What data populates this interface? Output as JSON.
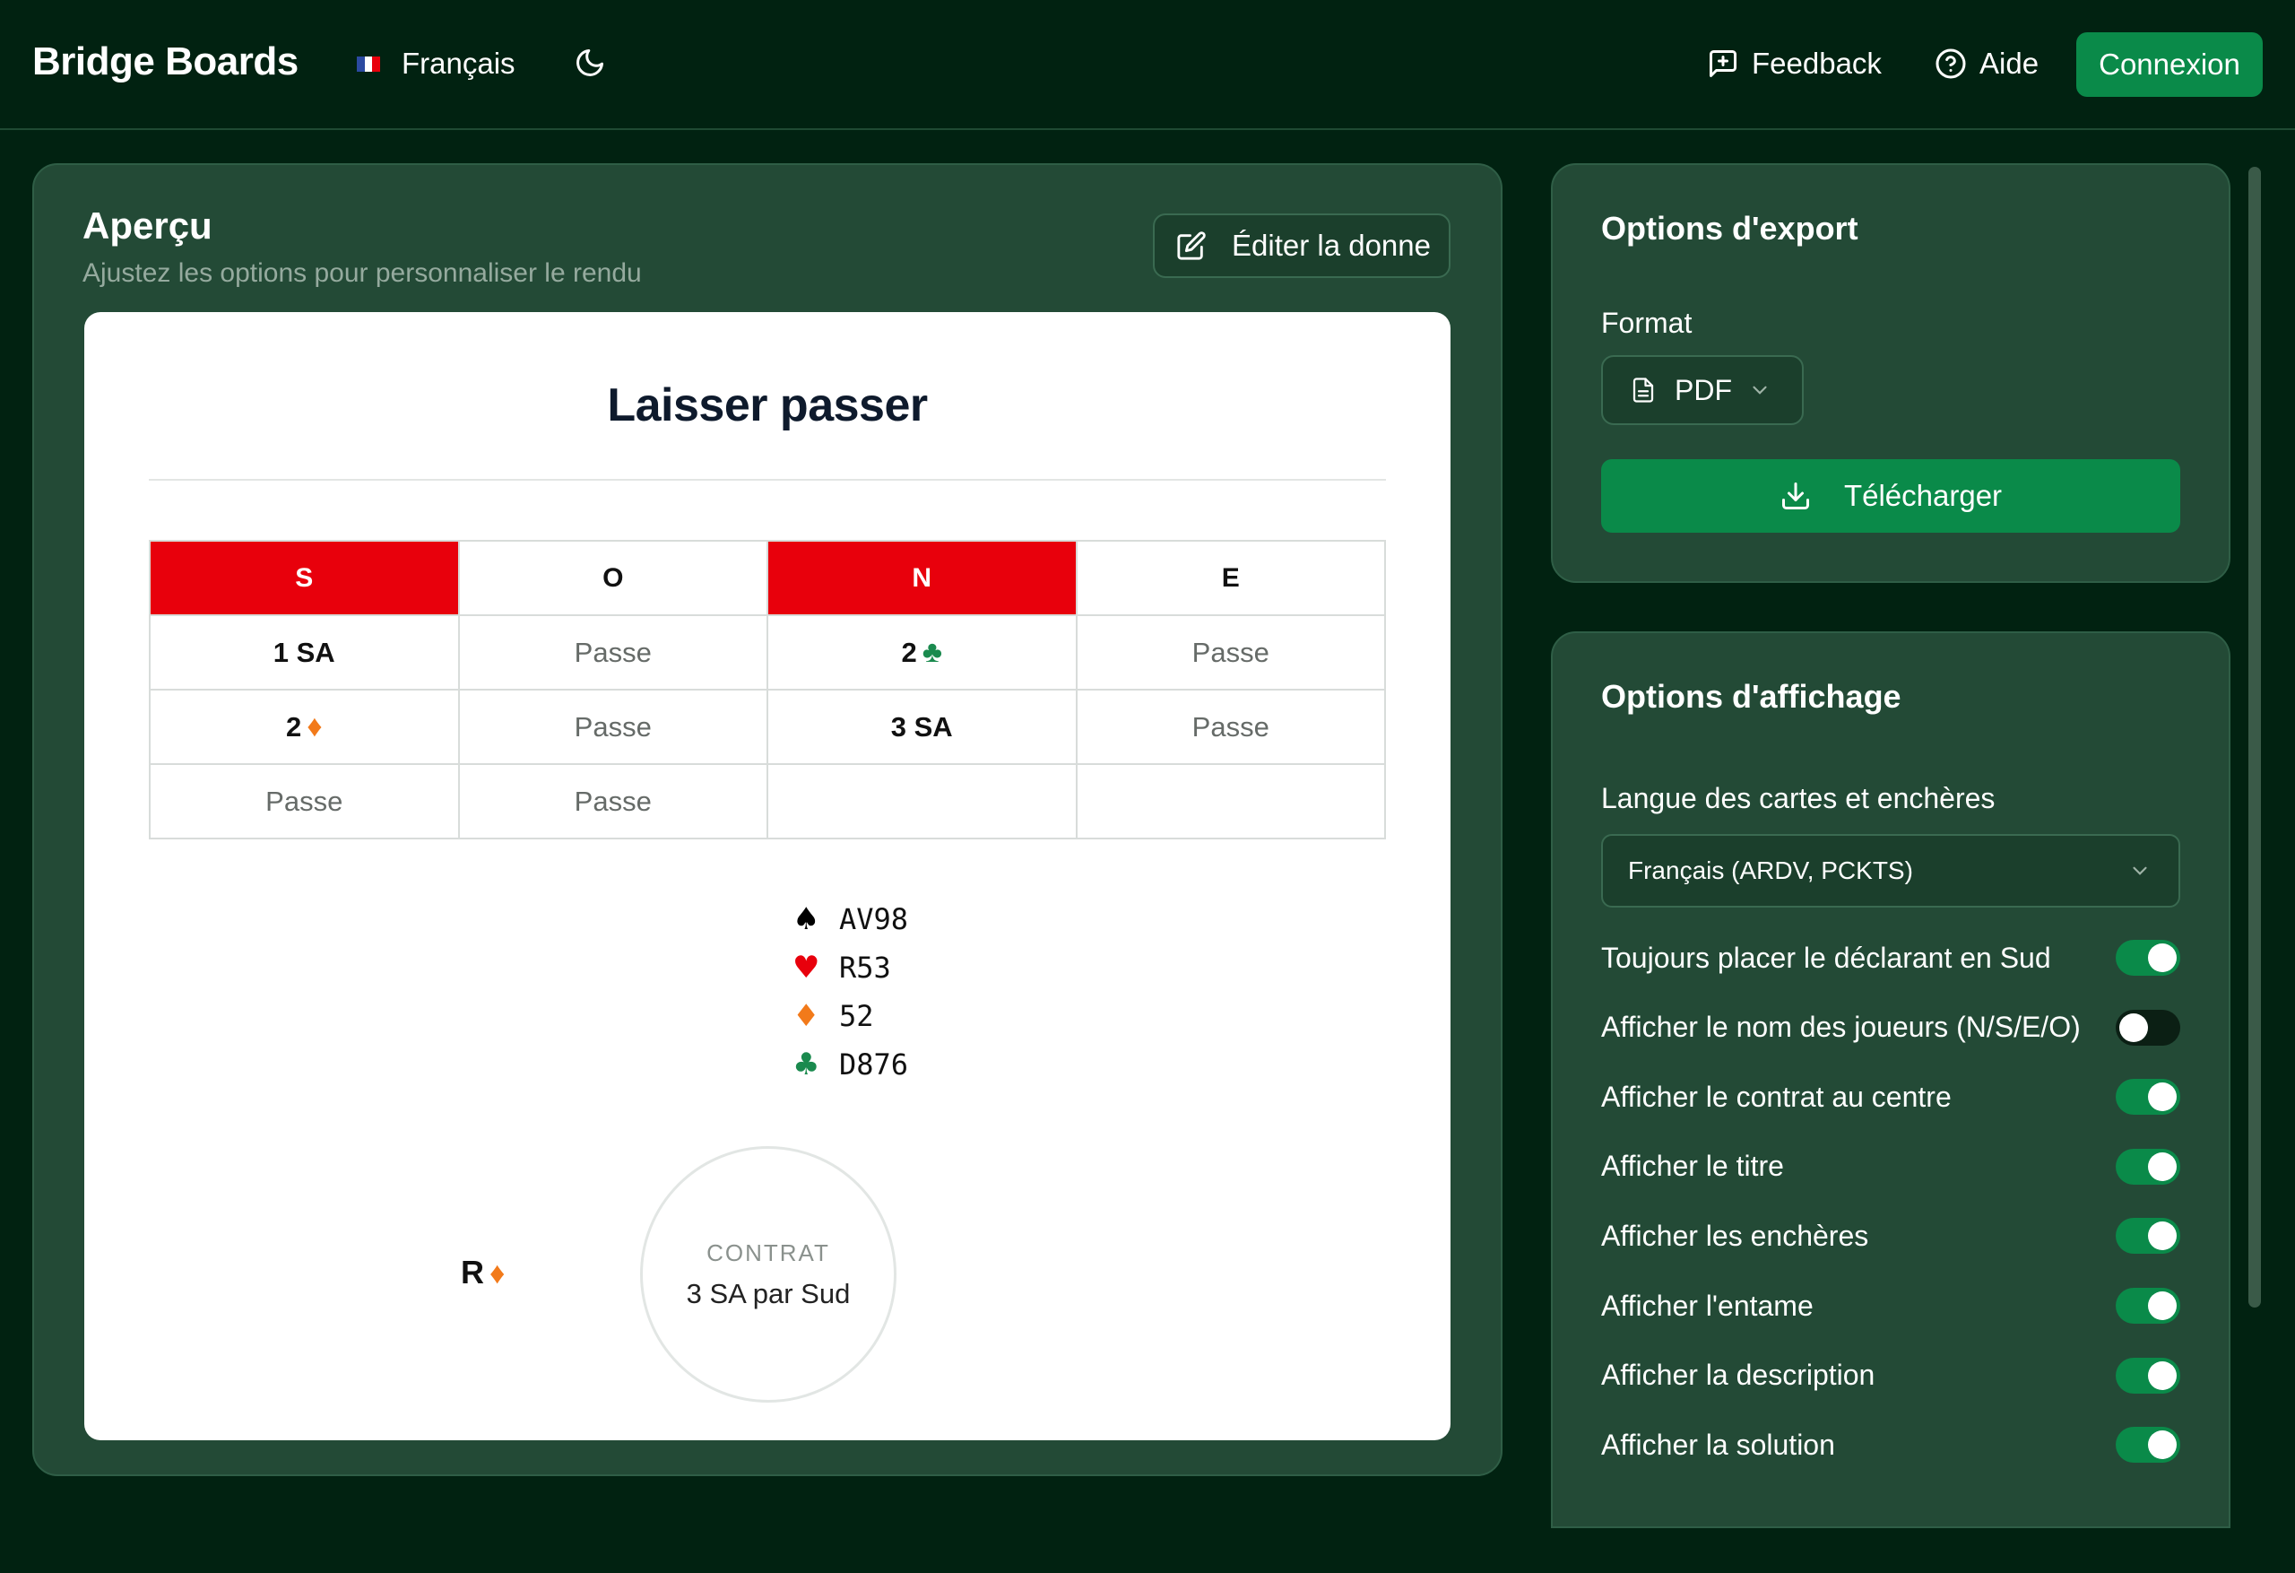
{
  "header": {
    "brand": "Bridge Boards",
    "language": "Français",
    "feedback": "Feedback",
    "help": "Aide",
    "login": "Connexion"
  },
  "preview": {
    "title": "Aperçu",
    "subtitle": "Ajustez les options pour personnaliser le rendu",
    "edit_label": "Éditer la donne",
    "board_title": "Laisser passer",
    "columns": [
      "S",
      "O",
      "N",
      "E"
    ],
    "bidding": [
      [
        {
          "text": "1 SA",
          "suit": "",
          "type": "bid"
        },
        {
          "text": "Passe",
          "suit": "",
          "type": "pass"
        },
        {
          "text": "2",
          "suit": "club",
          "type": "bid"
        },
        {
          "text": "Passe",
          "suit": "",
          "type": "pass"
        }
      ],
      [
        {
          "text": "2",
          "suit": "diamond",
          "type": "bid"
        },
        {
          "text": "Passe",
          "suit": "",
          "type": "pass"
        },
        {
          "text": "3 SA",
          "suit": "",
          "type": "bid"
        },
        {
          "text": "Passe",
          "suit": "",
          "type": "pass"
        }
      ],
      [
        {
          "text": "Passe",
          "suit": "",
          "type": "pass"
        },
        {
          "text": "Passe",
          "suit": "",
          "type": "pass"
        },
        {
          "text": "",
          "suit": "",
          "type": "empty"
        },
        {
          "text": "",
          "suit": "",
          "type": "empty"
        }
      ]
    ],
    "hand": {
      "spades": "AV98",
      "hearts": "R53",
      "diamonds": "52",
      "clubs": "D876"
    },
    "lead": "R",
    "contract_label": "CONTRAT",
    "contract_value": "3 SA par Sud"
  },
  "export": {
    "title": "Options d'export",
    "format_label": "Format",
    "format_value": "PDF",
    "download": "Télécharger"
  },
  "display": {
    "title": "Options d'affichage",
    "lang_label": "Langue des cartes et enchères",
    "lang_value": "Français (ARDV, PCKTS)",
    "options": [
      {
        "label": "Toujours placer le déclarant en Sud",
        "on": true
      },
      {
        "label": "Afficher le nom des joueurs (N/S/E/O)",
        "on": false
      },
      {
        "label": "Afficher le contrat au centre",
        "on": true
      },
      {
        "label": "Afficher le titre",
        "on": true
      },
      {
        "label": "Afficher les enchères",
        "on": true
      },
      {
        "label": "Afficher l'entame",
        "on": true
      },
      {
        "label": "Afficher la description",
        "on": true
      },
      {
        "label": "Afficher la solution",
        "on": true
      }
    ]
  },
  "colors": {
    "accent": "#0a8a49",
    "vulnerable": "#e8000c",
    "diamond": "#f27a1a",
    "club": "#1a8a4e",
    "heart": "#e8000c",
    "spade": "#000000"
  }
}
